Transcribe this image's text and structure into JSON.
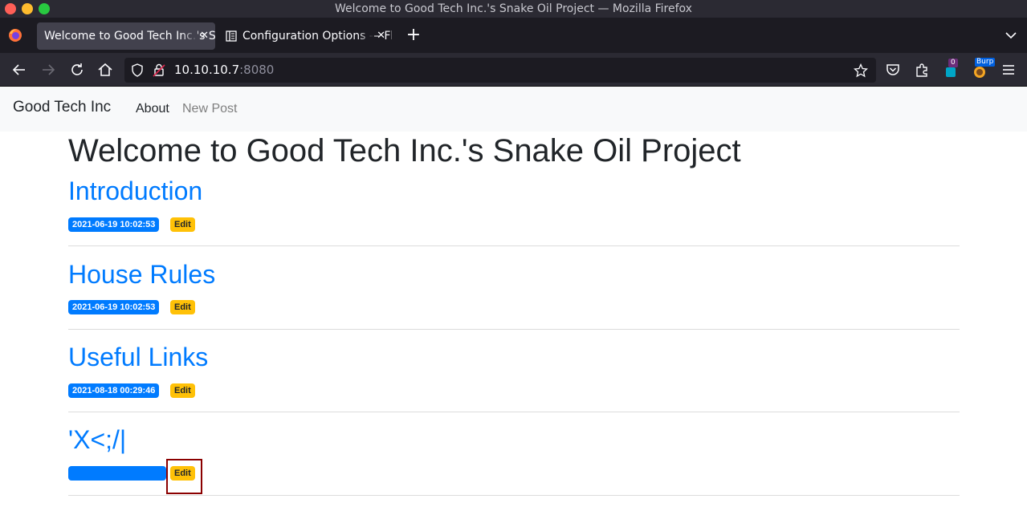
{
  "browser": {
    "window_title": "Welcome to Good Tech Inc.'s Snake Oil Project — Mozilla Firefox",
    "tabs": [
      {
        "label": "Welcome to Good Tech Inc.'s Snake Oil Project",
        "active": true,
        "icon": "none"
      },
      {
        "label": "Configuration Options — Flask-SQLAlchemy",
        "active": false,
        "icon": "document-icon"
      }
    ],
    "url": {
      "host": "10.10.10.7",
      "port": ":8080"
    },
    "extension_badge_count": "0",
    "burp_label": "Burp"
  },
  "site": {
    "brand": "Good Tech Inc",
    "nav": {
      "about": "About",
      "new_post": "New Post"
    },
    "heading": "Welcome to Good Tech Inc.'s Snake Oil Project",
    "posts": [
      {
        "title": "Introduction",
        "date": "2021-06-19 10:02:53",
        "edit": "Edit"
      },
      {
        "title": "House Rules",
        "date": "2021-06-19 10:02:53",
        "edit": "Edit"
      },
      {
        "title": "Useful Links",
        "date": "2021-08-18 00:29:46",
        "edit": "Edit"
      },
      {
        "title": "'X<;/|",
        "date": "",
        "edit": "Edit"
      }
    ]
  },
  "colors": {
    "link": "#007bff",
    "badge_primary": "#007bff",
    "badge_warning": "#ffc107",
    "highlight": "#8b0000"
  }
}
